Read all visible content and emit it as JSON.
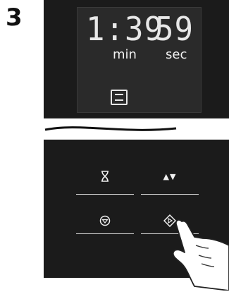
{
  "step": {
    "number": "3"
  },
  "display": {
    "minutes_digits": "1:39",
    "minutes_unit": "min",
    "seconds_digits": "59",
    "seconds_unit": "sec",
    "program_icon": "program-icon"
  },
  "controls": {
    "timer_icon": "hourglass-icon",
    "updown_label": "▲▼",
    "stop_icon": "stop-icon",
    "start_icon": "start-icon"
  },
  "hand_icon": "pointing-hand-icon"
}
